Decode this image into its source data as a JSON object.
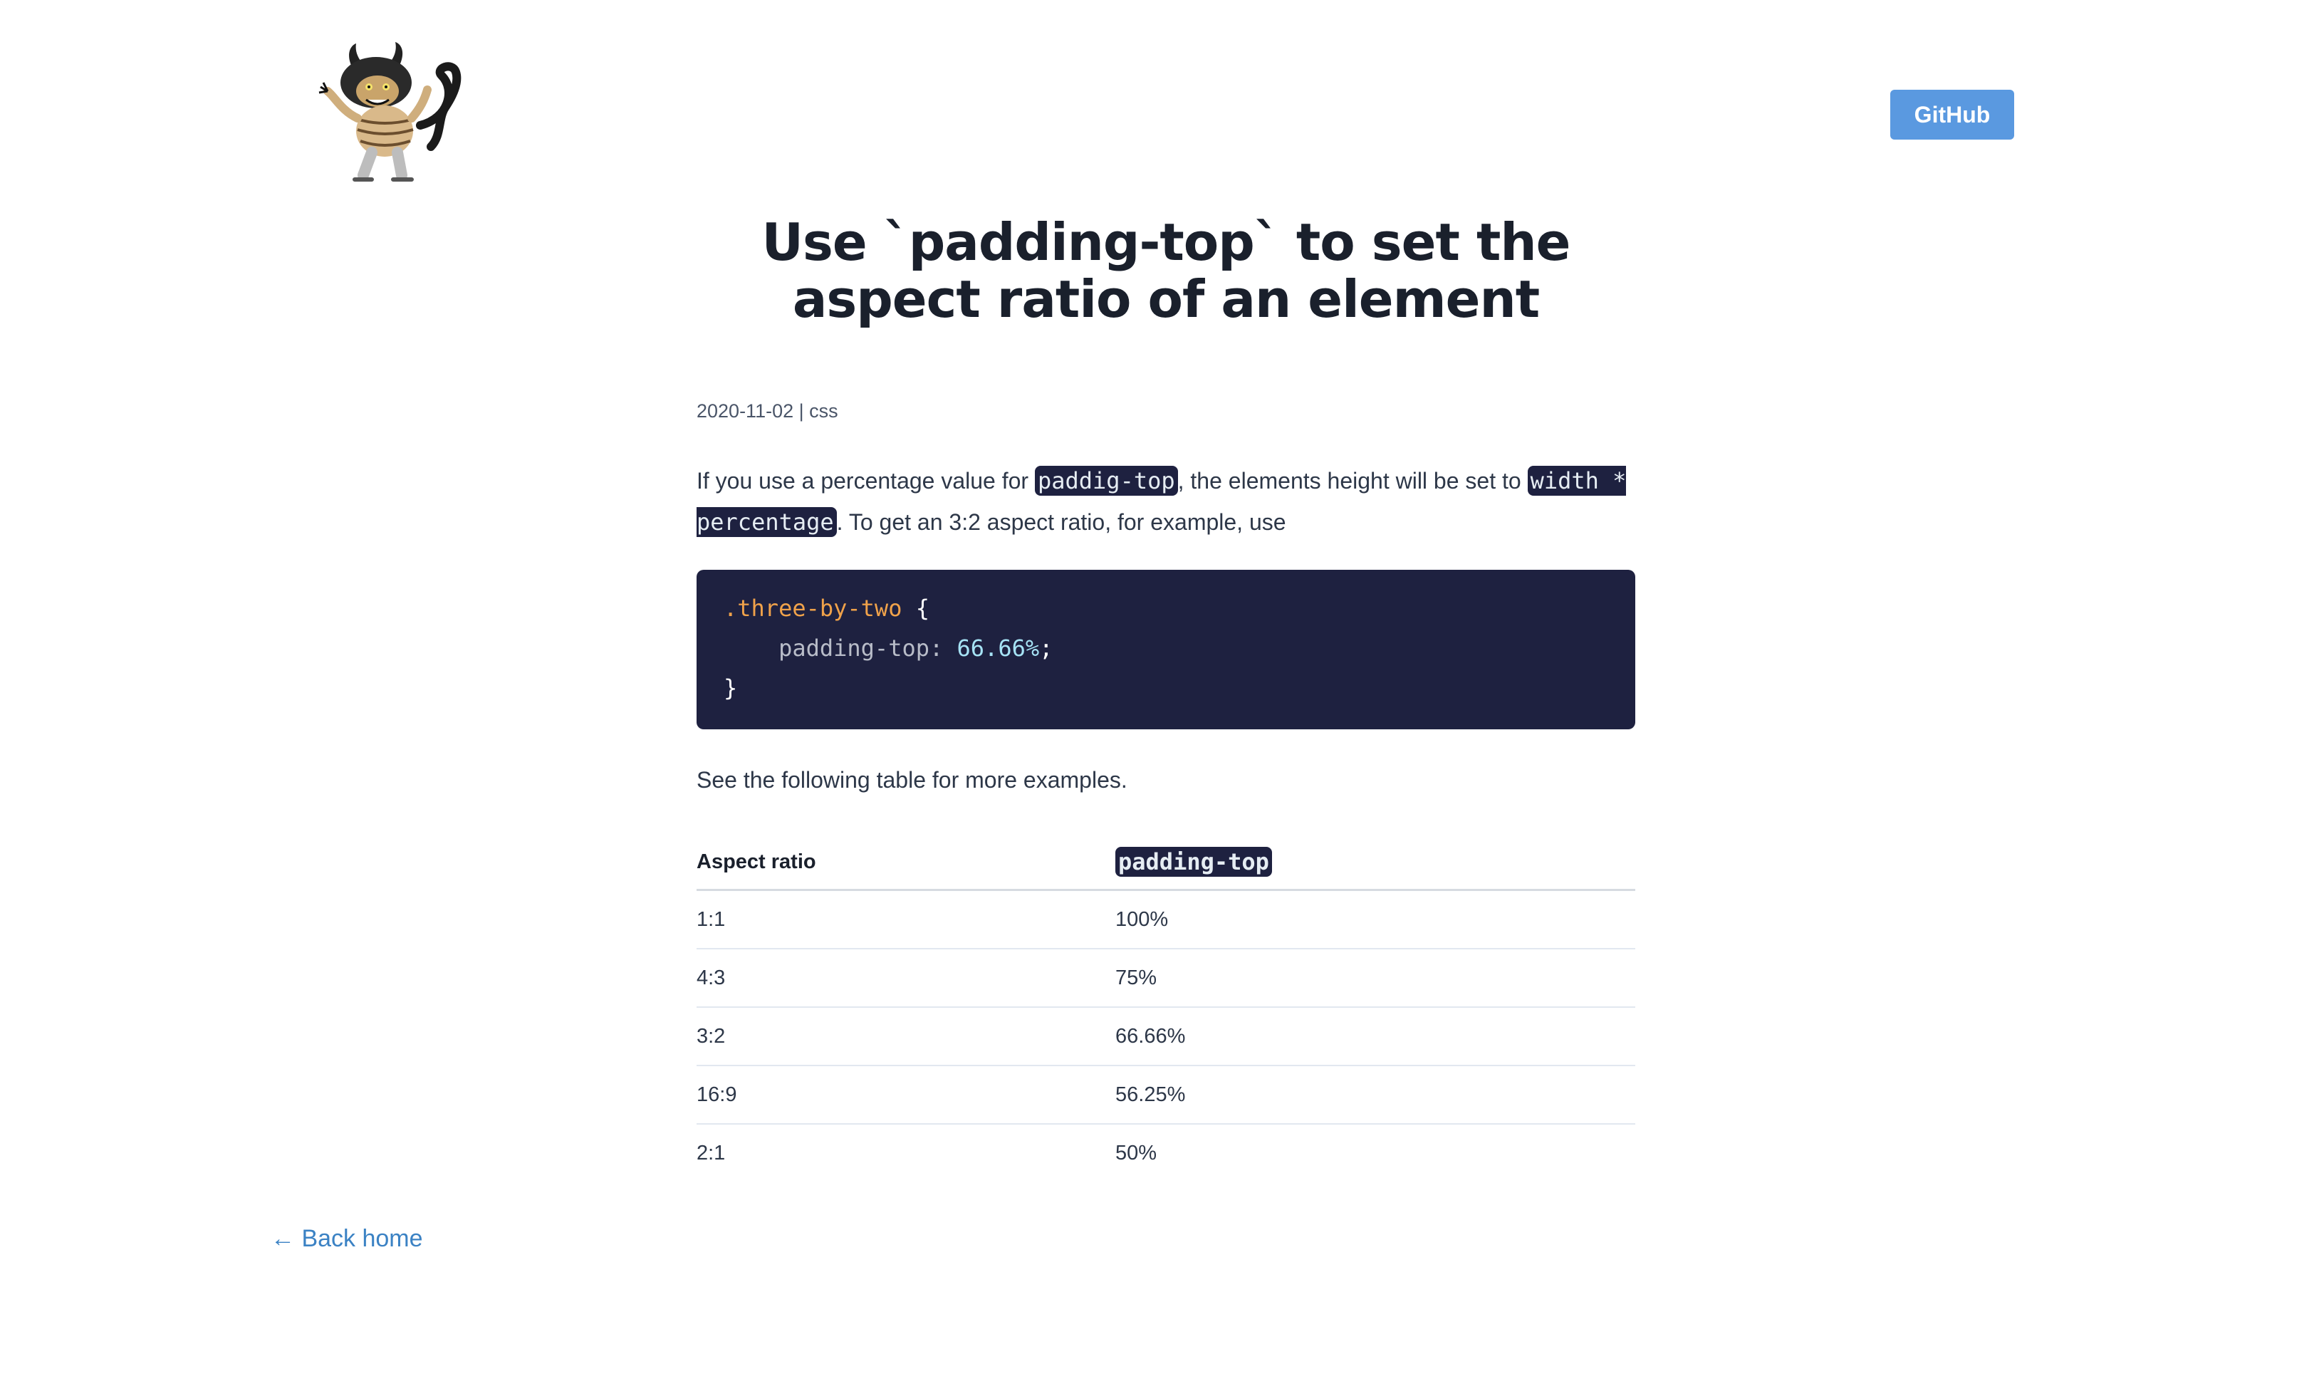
{
  "header": {
    "logo_alt": "Wild thing monster illustration",
    "github_label": "GitHub"
  },
  "article": {
    "title": "Use `padding-top` to set the aspect ratio of an element",
    "meta": "2020-11-02 | css",
    "intro": {
      "text_before": "If you use a percentage value for ",
      "code_1": "paddig-top",
      "text_middle": ", the elements height will be set to ",
      "code_2": "width * percentage",
      "text_after": ". To get an 3:2 aspect ratio, for example, use"
    },
    "code_block": {
      "selector": ".three-by-two",
      "open_brace": "{",
      "property": "padding-top:",
      "value": "66.66%",
      "semicolon": ";",
      "close_brace": "}"
    },
    "followup": "See the following table for more examples.",
    "table": {
      "headers": [
        "Aspect ratio",
        "padding-top"
      ],
      "rows": [
        [
          "1:1",
          "100%"
        ],
        [
          "4:3",
          "75%"
        ],
        [
          "3:2",
          "66.66%"
        ],
        [
          "16:9",
          "56.25%"
        ],
        [
          "2:1",
          "50%"
        ]
      ]
    }
  },
  "footer": {
    "back_link": "← Back home"
  },
  "colors": {
    "accent": "#5a99e0",
    "link": "#3b82c4",
    "code_bg": "#1e2140",
    "heading": "#1a202c"
  }
}
